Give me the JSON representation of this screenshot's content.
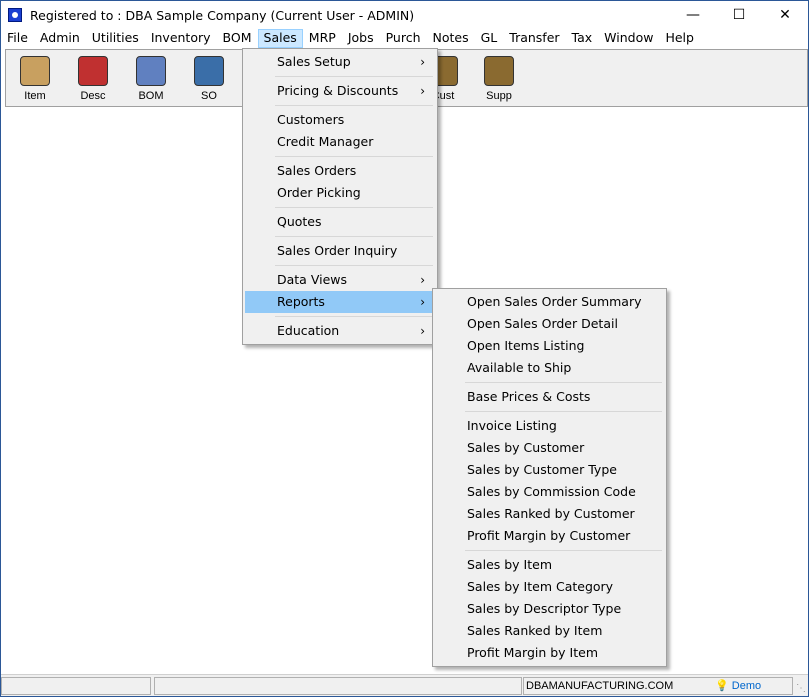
{
  "window": {
    "title": "Registered to : DBA Sample Company (Current User - ADMIN)",
    "controls": [
      "minimize",
      "maximize",
      "close"
    ]
  },
  "menubar": [
    "File",
    "Admin",
    "Utilities",
    "Inventory",
    "BOM",
    "Sales",
    "MRP",
    "Jobs",
    "Purch",
    "Notes",
    "GL",
    "Transfer",
    "Tax",
    "Window",
    "Help"
  ],
  "active_menu": "Sales",
  "toolbar": [
    {
      "label": "Item",
      "icon": "item-icon",
      "color": "#c8a060"
    },
    {
      "label": "Desc",
      "icon": "desc-icon",
      "color": "#c03030"
    },
    {
      "label": "BOM",
      "icon": "bom-icon",
      "color": "#6080c0"
    },
    {
      "label": "SO",
      "icon": "so-icon",
      "color": "#3a6ea8"
    },
    {
      "label": "Cust",
      "icon": "folder-icon",
      "color": "#8a6a30"
    },
    {
      "label": "Supp",
      "icon": "folder-icon",
      "color": "#8a6a30"
    }
  ],
  "sales_menu": [
    {
      "label": "Sales Setup",
      "submenu": true
    },
    "sep",
    {
      "label": "Pricing & Discounts",
      "submenu": true
    },
    "sep",
    {
      "label": "Customers"
    },
    {
      "label": "Credit Manager"
    },
    "sep",
    {
      "label": "Sales Orders"
    },
    {
      "label": "Order Picking"
    },
    "sep",
    {
      "label": "Quotes"
    },
    "sep",
    {
      "label": "Sales Order Inquiry"
    },
    "sep",
    {
      "label": "Data Views",
      "submenu": true
    },
    {
      "label": "Reports",
      "submenu": true,
      "highlighted": true
    },
    "sep",
    {
      "label": "Education",
      "submenu": true
    }
  ],
  "reports_menu": [
    {
      "label": "Open Sales Order Summary"
    },
    {
      "label": "Open Sales Order Detail"
    },
    {
      "label": "Open Items Listing"
    },
    {
      "label": "Available to Ship"
    },
    "sep",
    {
      "label": "Base Prices & Costs"
    },
    "sep",
    {
      "label": "Invoice Listing"
    },
    {
      "label": "Sales by Customer"
    },
    {
      "label": "Sales by Customer Type"
    },
    {
      "label": "Sales by Commission Code"
    },
    {
      "label": "Sales Ranked by Customer"
    },
    {
      "label": "Profit Margin by Customer"
    },
    "sep",
    {
      "label": "Sales by Item"
    },
    {
      "label": "Sales by Item Category"
    },
    {
      "label": "Sales by Descriptor Type"
    },
    {
      "label": "Sales Ranked by Item"
    },
    {
      "label": "Profit Margin by Item"
    }
  ],
  "status": {
    "website": "DBAMANUFACTURING.COM",
    "mode": "Demo",
    "mode_color": "#0066cc"
  }
}
